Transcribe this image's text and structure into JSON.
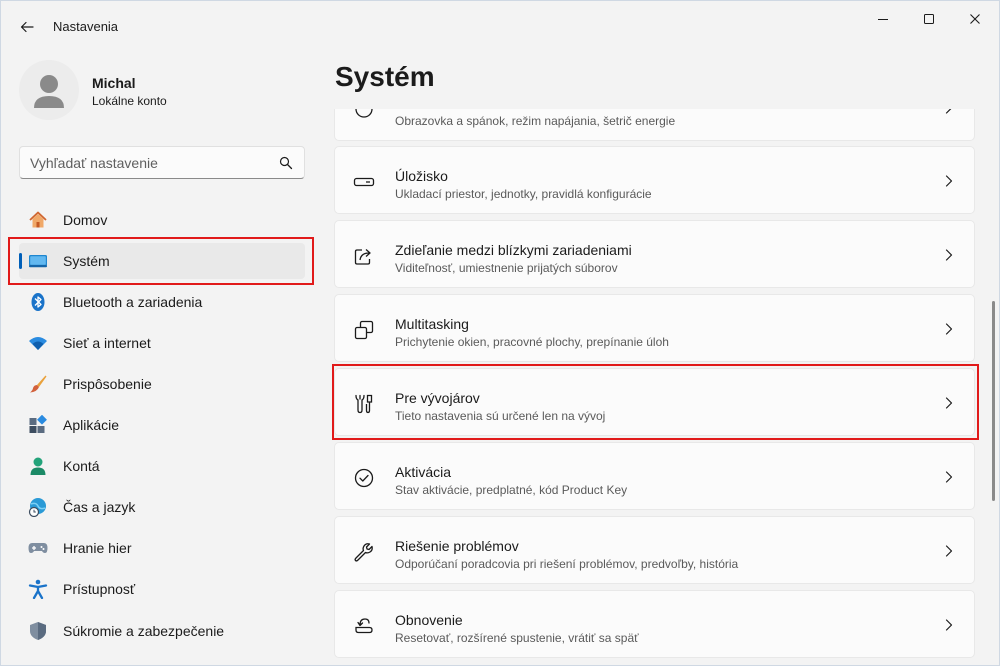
{
  "app": {
    "title": "Nastavenia"
  },
  "profile": {
    "name": "Michal",
    "account_type": "Lokálne konto"
  },
  "search": {
    "placeholder": "Vyhľadať nastavenie"
  },
  "sidebar": {
    "items": [
      {
        "label": "Domov",
        "icon": "home-icon"
      },
      {
        "label": "Systém",
        "icon": "system-icon",
        "active": true
      },
      {
        "label": "Bluetooth a zariadenia",
        "icon": "bluetooth-icon"
      },
      {
        "label": "Sieť a internet",
        "icon": "wifi-icon"
      },
      {
        "label": "Prispôsobenie",
        "icon": "brush-icon"
      },
      {
        "label": "Aplikácie",
        "icon": "apps-icon"
      },
      {
        "label": "Kontá",
        "icon": "account-icon"
      },
      {
        "label": "Čas a jazyk",
        "icon": "globe-clock-icon"
      },
      {
        "label": "Hranie hier",
        "icon": "gamepad-icon"
      },
      {
        "label": "Prístupnosť",
        "icon": "accessibility-icon"
      },
      {
        "label": "Súkromie a zabezpečenie",
        "icon": "shield-icon"
      }
    ]
  },
  "main": {
    "title": "Systém",
    "cards": [
      {
        "title": "",
        "subtitle": "Obrazovka a spánok, režim napájania, šetrič energie",
        "icon": "power-icon"
      },
      {
        "title": "Úložisko",
        "subtitle": "Ukladací priestor, jednotky, pravidlá konfigurácie",
        "icon": "storage-icon"
      },
      {
        "title": "Zdieľanie medzi blízkymi zariadeniami",
        "subtitle": "Viditeľnosť, umiestnenie prijatých súborov",
        "icon": "share-icon"
      },
      {
        "title": "Multitasking",
        "subtitle": "Prichytenie okien, pracovné plochy, prepínanie úloh",
        "icon": "multitasking-icon"
      },
      {
        "title": "Pre vývojárov",
        "subtitle": "Tieto nastavenia sú určené len na vývoj",
        "icon": "developer-tools-icon"
      },
      {
        "title": "Aktivácia",
        "subtitle": "Stav aktivácie, predplatné, kód Product Key",
        "icon": "activation-check-icon"
      },
      {
        "title": "Riešenie problémov",
        "subtitle": "Odporúčaní poradcovia pri riešení problémov, predvoľby, história",
        "icon": "wrench-icon"
      },
      {
        "title": "Obnovenie",
        "subtitle": "Resetovať, rozšírené spustenie, vrátiť sa späť",
        "icon": "recovery-icon"
      }
    ]
  },
  "colors": {
    "accent": "#005fb8",
    "highlight": "#e11a1a"
  }
}
